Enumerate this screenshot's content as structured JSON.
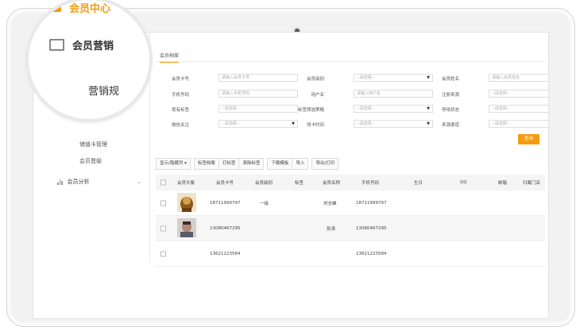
{
  "lens": {
    "item1": "会员中心",
    "item2": "会员营销",
    "sub": "营销规"
  },
  "sidebar": {
    "sub_items": [
      "储值卡管理",
      "会员晋级"
    ],
    "analysis": "会员分析"
  },
  "tab": "会员档案",
  "form": {
    "fields": [
      {
        "label": "会员卡号",
        "value": "请输入会员卡号",
        "select": false
      },
      {
        "label": "会员级别",
        "value": "--请选择--",
        "select": true
      },
      {
        "label": "会员姓名",
        "value": "请输入会员姓名",
        "select": false
      },
      {
        "label": "手机号码",
        "value": "请输入手机号码",
        "select": false
      },
      {
        "label": "用户名",
        "value": "请输入用户名",
        "select": false
      },
      {
        "label": "注册来源",
        "value": "--请选择--",
        "select": true
      },
      {
        "label": "现有标签",
        "value": "--请选择--",
        "select": false
      },
      {
        "label": "标签筛选策略",
        "value": "--请选择--",
        "select": true
      },
      {
        "label": "停用状态",
        "value": "--请选择--",
        "select": true
      },
      {
        "label": "微信关注",
        "value": "--请选择--",
        "select": true
      },
      {
        "label": "领卡时间",
        "value": "--请选择--",
        "select": true
      },
      {
        "label": "来源渠道",
        "value": "--请选择--",
        "select": true
      }
    ],
    "query_button": "查询"
  },
  "toolbar": {
    "show_hide": "显示/隐藏列",
    "group1": [
      "标签档案",
      "打标签",
      "清除标签"
    ],
    "group2": [
      "下载模板",
      "导入"
    ],
    "export": "导出/打印"
  },
  "table": {
    "headers": [
      "会员头像",
      "会员卡号",
      "会员级别",
      "标签",
      "会员名称",
      "手机号码",
      "生日",
      "QQ",
      "邮箱",
      "归属门店"
    ],
    "rows": [
      {
        "card": "18711999797",
        "level": "一级",
        "name": "刘志峰",
        "phone": "18711999797",
        "avatar": "cartoon-avatar"
      },
      {
        "card": "13080467295",
        "level": "",
        "name": "张涛",
        "phone": "13080467295",
        "avatar": "photo-avatar"
      },
      {
        "card": "13621223584",
        "level": "",
        "name": "",
        "phone": "13621223584",
        "avatar": ""
      }
    ]
  },
  "colors": {
    "accent": "#f39c12",
    "lens_item1": "#f39c12",
    "lens_item2": "#333333"
  }
}
